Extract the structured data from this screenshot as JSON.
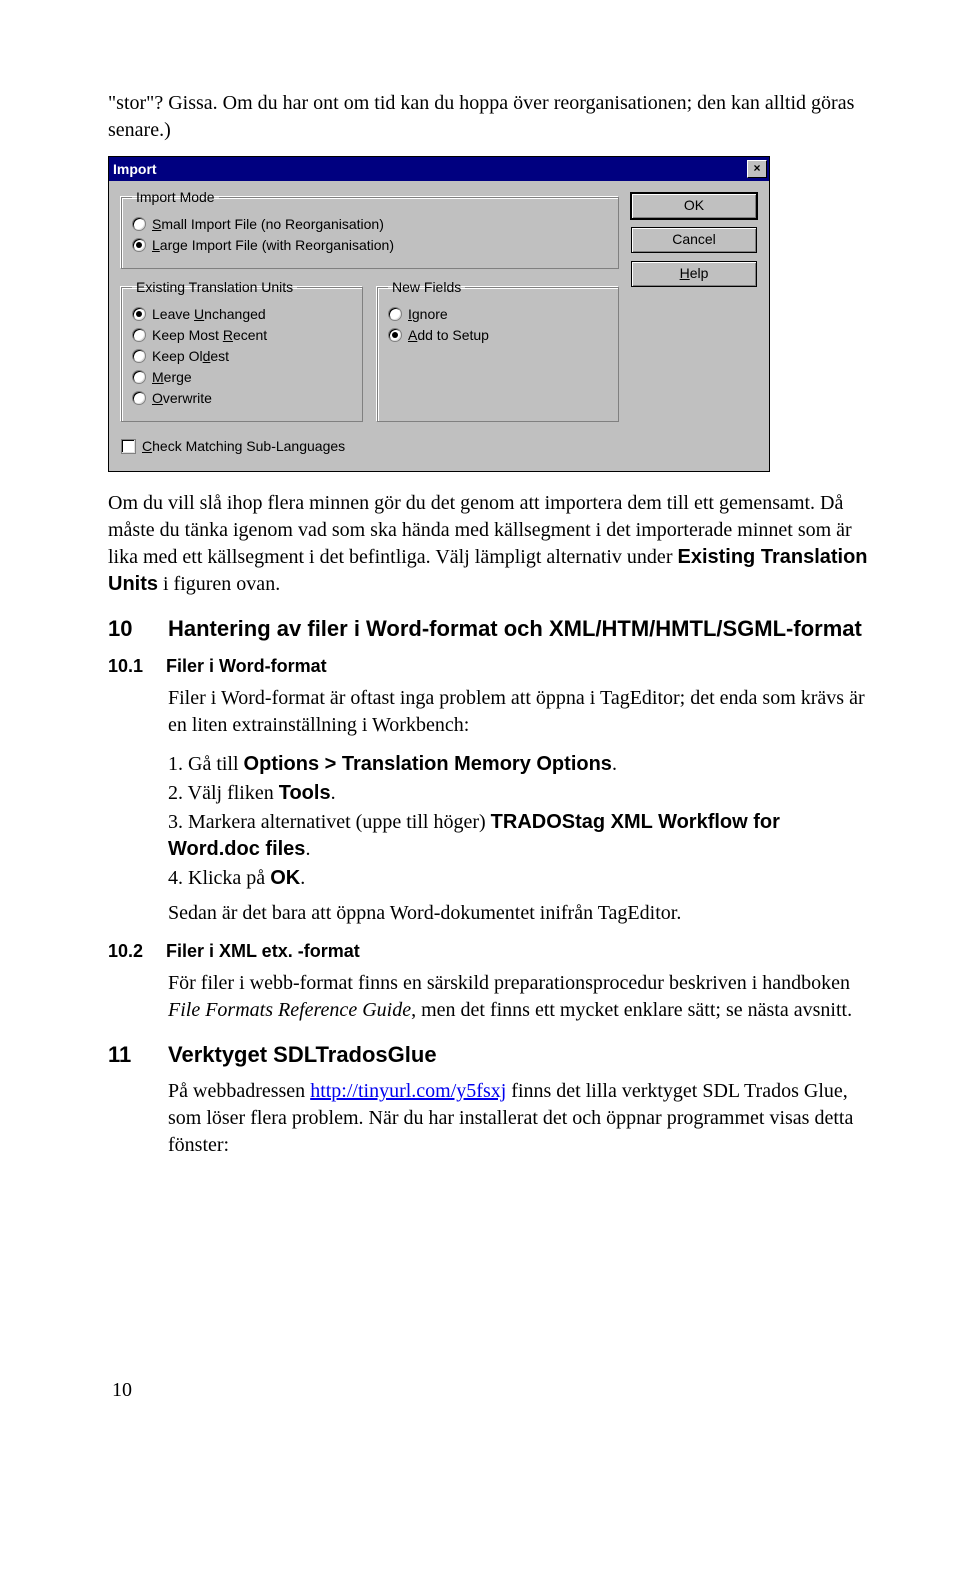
{
  "intro": {
    "p1": "\"stor\"? Gissa. Om du har ont om tid kan du hoppa över reorganisationen; den kan alltid göras senare.)"
  },
  "dialog": {
    "title": "Import",
    "close": "×",
    "buttons": {
      "ok": "OK",
      "cancel": "Cancel",
      "help": "Help"
    },
    "importMode": {
      "legend": "Import Mode",
      "opt1_pre": "S",
      "opt1_rest": "mall Import File (no Reorganisation)",
      "opt2_pre": "L",
      "opt2_rest": "arge Import File (with Reorganisation)"
    },
    "existing": {
      "legend": "Existing Translation Units",
      "u_pre": "Leave ",
      "u_und": "U",
      "u_rest": "nchanged",
      "r_pre": "Keep Most ",
      "r_und": "R",
      "r_rest": "ecent",
      "d_pre": "Keep Ol",
      "d_und": "d",
      "d_rest": "est",
      "m_und": "M",
      "m_rest": "erge",
      "o_und": "O",
      "o_rest": "verwrite"
    },
    "newFields": {
      "legend": "New Fields",
      "ig_und": "I",
      "ig_rest": "gnore",
      "add_und": "A",
      "add_rest": "dd to Setup"
    },
    "check_und": "C",
    "check_rest": "heck Matching Sub-Languages"
  },
  "after": {
    "p1a": "Om du vill slå ihop flera minnen gör du det genom att importera dem till ett gemensamt. Då måste du tänka igenom vad som ska hända med källsegment i det importerade minnet som är lika med ett källsegment i det befintliga. Välj lämpligt alternativ under ",
    "p1b": "Existing Translation Units",
    "p1c": " i figuren ovan."
  },
  "h10": {
    "num": "10",
    "title": "Hantering av filer i Word-format och XML/HTM/HMTL/SGML-format"
  },
  "h10_1": {
    "num": "10.1",
    "title": "Filer i Word-format",
    "p": "Filer i Word-format är oftast inga problem att öppna i TagEditor; det enda som krävs är en liten extrainställning i Workbench:",
    "li1a": "1.  Gå till ",
    "li1b": "Options > Translation Memory Options",
    "li1c": ".",
    "li2a": "2.  Välj fliken ",
    "li2b": "Tools",
    "li2c": ".",
    "li3a": "3.  Markera alternativet (uppe till höger) ",
    "li3b": "TRADOStag XML Workflow for Word",
    "li3c": ".doc files",
    "li3d": ".",
    "li4a": "4.  Klicka på ",
    "li4b": "OK",
    "li4c": ".",
    "p2": "Sedan är det bara att öppna Word-dokumentet inifrån TagEditor."
  },
  "h10_2": {
    "num": "10.2",
    "title": "Filer i XML etx. -format",
    "p_a": "För filer i webb-format finns en särskild preparationsprocedur beskriven i handboken ",
    "p_i": "File Formats Reference Guide",
    "p_b": ", men det finns ett mycket enklare sätt; se nästa avsnitt."
  },
  "h11": {
    "num": "11",
    "title": "Verktyget SDLTradosGlue",
    "p_a": "På webbadressen ",
    "link": "http://tinyurl.com/y5fsxj",
    "p_b": " finns det lilla verktyget SDL Trados Glue, som löser flera problem. När du har installerat det och öppnar programmet visas detta fönster:"
  },
  "pagenum": "10"
}
